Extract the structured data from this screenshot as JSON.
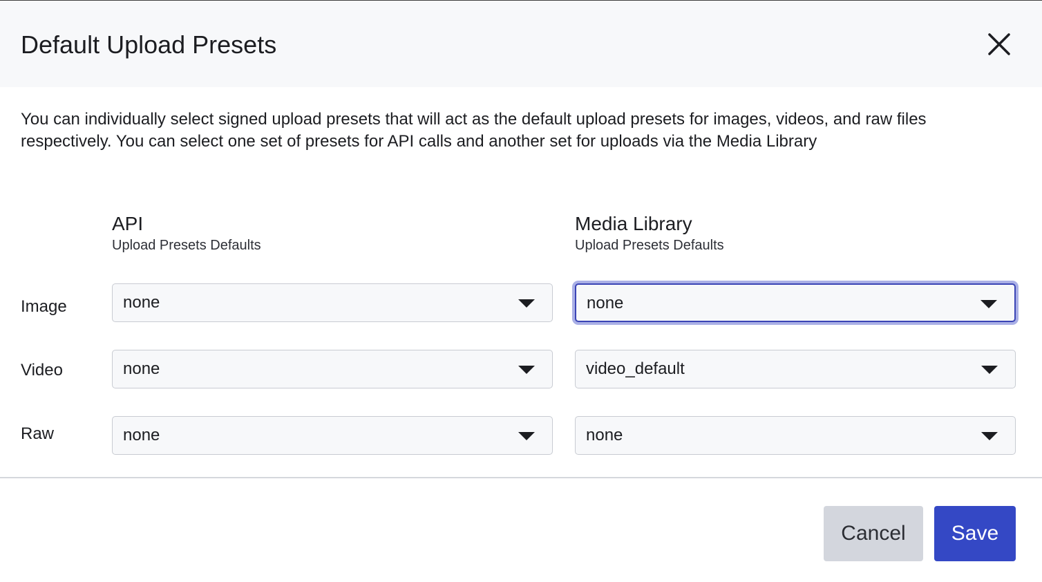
{
  "dialog": {
    "title": "Default Upload Presets",
    "close_icon": "close-icon",
    "description": "You can individually select signed upload presets that will act as the default upload presets for images, videos, and raw files respectively. You can select one set of presets for API calls and another set for uploads via the Media Library"
  },
  "columns": {
    "api": {
      "heading": "API",
      "subheading": "Upload Presets Defaults"
    },
    "media_library": {
      "heading": "Media Library",
      "subheading": "Upload Presets Defaults"
    }
  },
  "rows": {
    "image": {
      "label": "Image",
      "api_value": "none",
      "media_library_value": "none"
    },
    "video": {
      "label": "Video",
      "api_value": "none",
      "media_library_value": "video_default"
    },
    "raw": {
      "label": "Raw",
      "api_value": "none",
      "media_library_value": "none"
    }
  },
  "focused_select": "image.media_library",
  "dropdown_icon": "caret-down-icon",
  "footer": {
    "cancel_label": "Cancel",
    "save_label": "Save"
  },
  "colors": {
    "primary": "#3448c5",
    "focus_ring": "#aab0e6",
    "header_bg": "#f7f8fa",
    "cancel_bg": "#d3d6dd"
  }
}
